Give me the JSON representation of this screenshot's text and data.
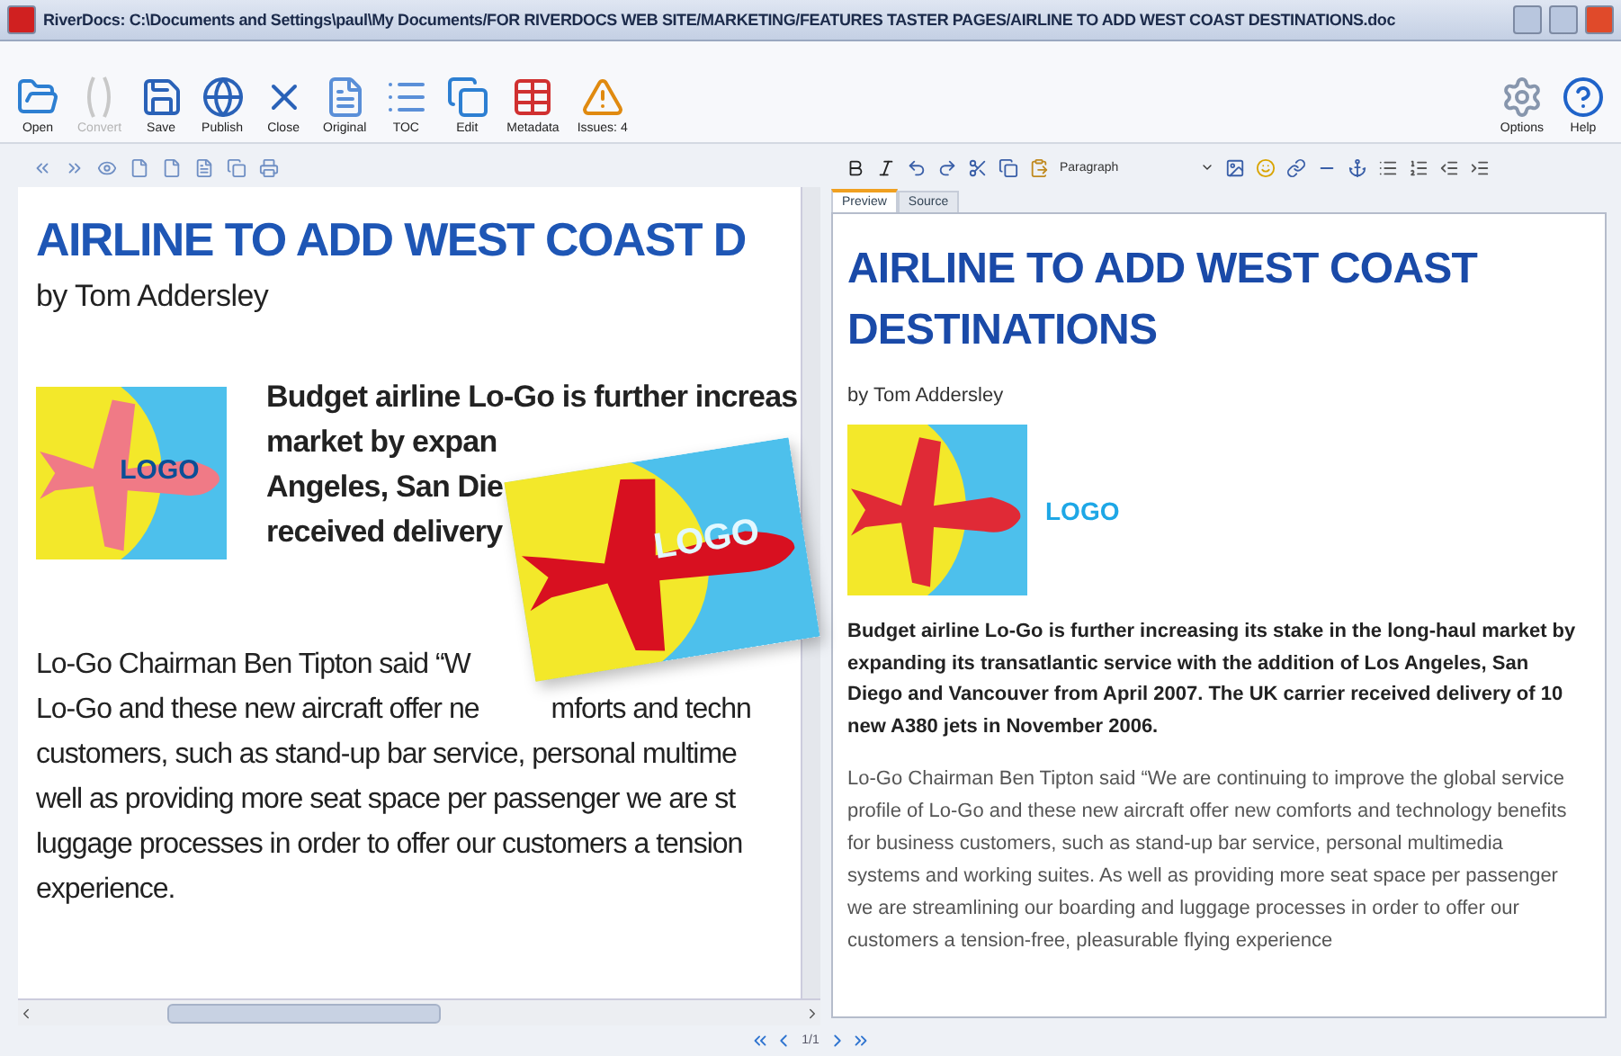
{
  "window": {
    "title": "RiverDocs: C:\\Documents and Settings\\paul\\My Documents/FOR RIVERDOCS WEB SITE/MARKETING/FEATURES TASTER PAGES/AIRLINE TO ADD WEST COAST DESTINATIONS.doc"
  },
  "toolbar": {
    "buttons": [
      {
        "label": "Open",
        "kind": "open",
        "disabled": false
      },
      {
        "label": "Convert",
        "kind": "convert",
        "disabled": true
      },
      {
        "label": "Save",
        "kind": "save",
        "disabled": false
      },
      {
        "label": "Publish",
        "kind": "publish",
        "disabled": false
      },
      {
        "label": "Close",
        "kind": "close",
        "disabled": false
      },
      {
        "label": "Original",
        "kind": "original",
        "disabled": false
      },
      {
        "label": "TOC",
        "kind": "toc",
        "disabled": false
      },
      {
        "label": "Edit",
        "kind": "edit",
        "disabled": false
      },
      {
        "label": "Metadata",
        "kind": "metadata",
        "disabled": false
      },
      {
        "label": "Issues: 4",
        "kind": "issues",
        "disabled": false
      }
    ],
    "right_buttons": [
      {
        "label": "Options",
        "kind": "options",
        "disabled": false
      },
      {
        "label": "Help",
        "kind": "help",
        "disabled": false
      }
    ]
  },
  "left_document": {
    "title": "AIRLINE TO ADD WEST COAST D",
    "byline": "by Tom Addersley",
    "logo": "LOGO",
    "lead_lines": [
      "Budget airline Lo-Go is further increas",
      "market by expan",
      "Angeles, San Die",
      "received delivery"
    ],
    "body_lines": [
      [
        "Lo-Go Chairman Ben Tipton said “W"
      ],
      [
        "Lo-Go and these new aircraft offer ne",
        "mforts and techn"
      ],
      [
        "customers, such as stand-up bar service, personal multime"
      ],
      [
        "well as providing more seat space per passenger we are st"
      ],
      [
        "luggage processes in order to offer our customers a tension"
      ],
      [
        "experience."
      ]
    ]
  },
  "floating_logo": {
    "text": "LOGO"
  },
  "editor": {
    "format": "Paragraph",
    "tabs": [
      {
        "label": "Preview",
        "selected": true
      },
      {
        "label": "Source",
        "selected": false
      }
    ],
    "title": "AIRLINE TO ADD WEST COAST DESTINATIONS",
    "byline": "by Tom Addersley",
    "logo": "LOGO",
    "lead": "Budget airline Lo-Go is further increasing its stake in the long-haul market by expanding its transatlantic service with the addition of Los Angeles, San Diego and Vancouver from April 2007. The UK carrier received delivery of 10 new A380 jets in November 2006.",
    "body": "Lo-Go Chairman Ben Tipton said “We are continuing to improve the global service profile of Lo-Go and these new aircraft offer new comforts and technology benefits for business customers, such as stand-up bar service, personal multimedia systems and working suites. As well as providing more seat space per passenger we are streamlining our boarding and luggage processes in order to offer our customers a tension-free, pleasurable flying experience"
  },
  "pager": {
    "page": "1/1"
  }
}
